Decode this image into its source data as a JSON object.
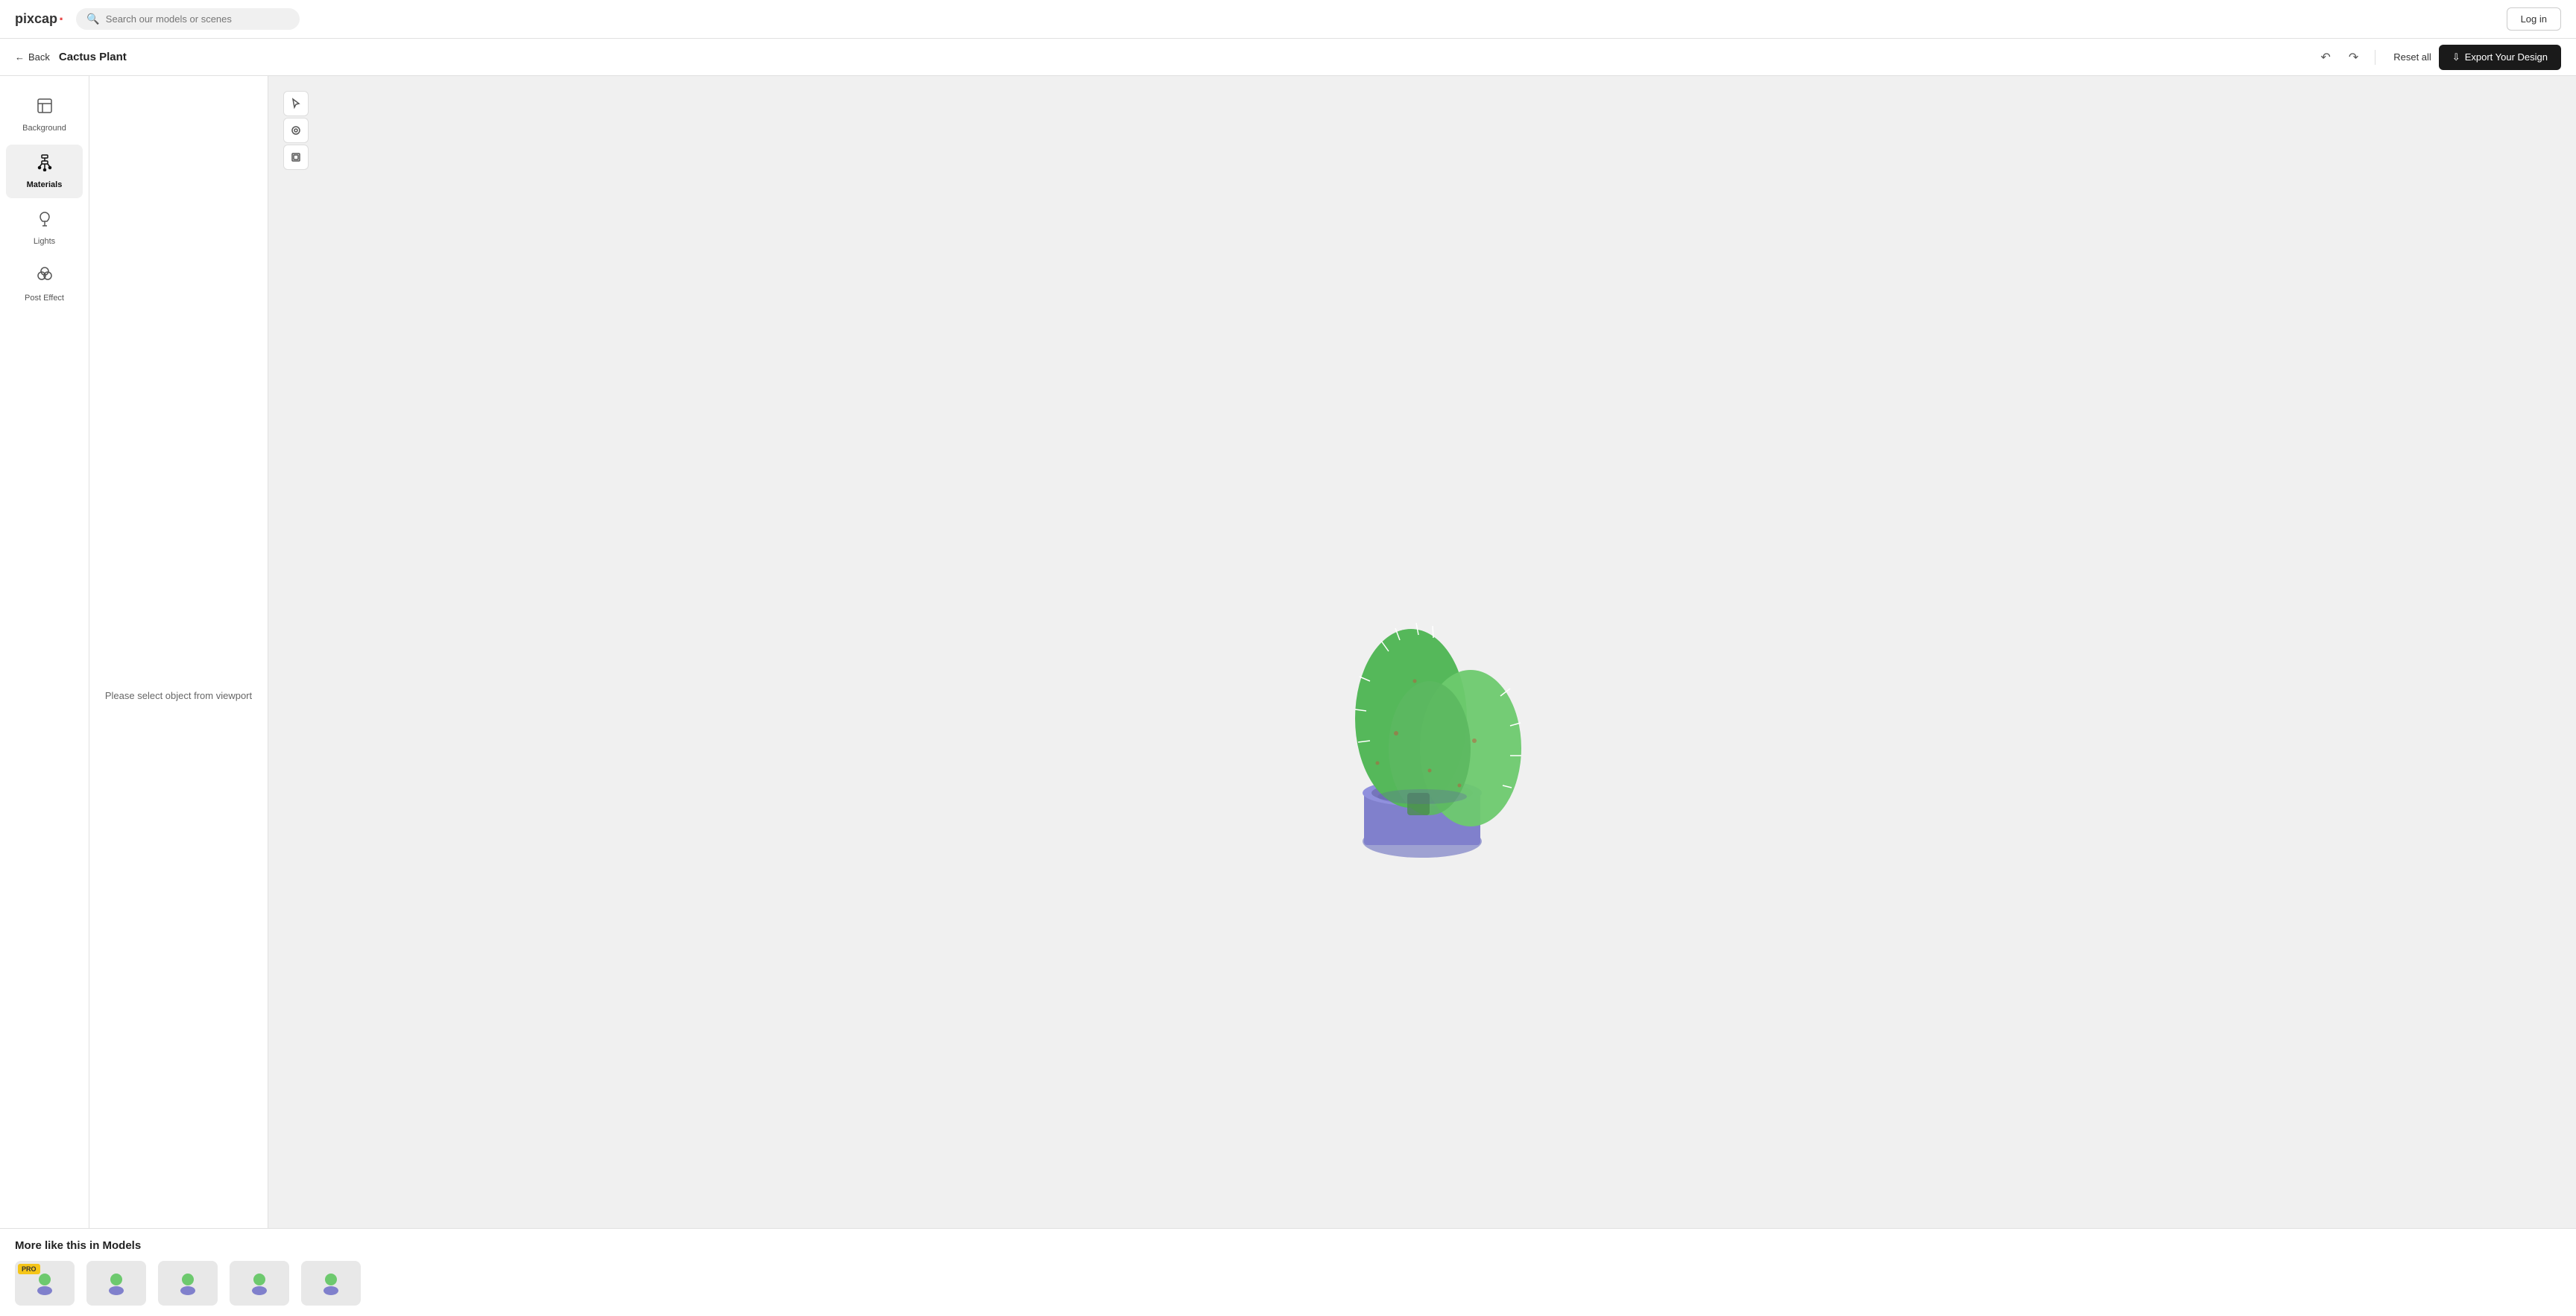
{
  "app": {
    "logo_text": "pixcap",
    "logo_dot": "·"
  },
  "navbar": {
    "search_placeholder": "Search our models or scenes",
    "login_label": "Log in"
  },
  "subheader": {
    "back_label": "Back",
    "title": "Cactus Plant",
    "reset_label": "Reset all",
    "export_label": "Export Your Design"
  },
  "sidebar": {
    "items": [
      {
        "id": "background",
        "label": "Background",
        "icon": "🖼"
      },
      {
        "id": "materials",
        "label": "Materials",
        "icon": "🖌",
        "active": true
      },
      {
        "id": "lights",
        "label": "Lights",
        "icon": "💡"
      },
      {
        "id": "post-effect",
        "label": "Post Effect",
        "icon": "⬡"
      }
    ]
  },
  "panel": {
    "message": "Please select object from viewport"
  },
  "viewport_tools": [
    {
      "id": "select",
      "icon": "⊹"
    },
    {
      "id": "rotate",
      "icon": "◎"
    },
    {
      "id": "frame",
      "icon": "⊡"
    }
  ],
  "bottom": {
    "section_title": "More like this in Models",
    "thumbnails": [
      {
        "id": "1",
        "pro": true
      },
      {
        "id": "2",
        "pro": false
      },
      {
        "id": "3",
        "pro": false
      },
      {
        "id": "4",
        "pro": false
      },
      {
        "id": "5",
        "pro": false
      }
    ]
  }
}
